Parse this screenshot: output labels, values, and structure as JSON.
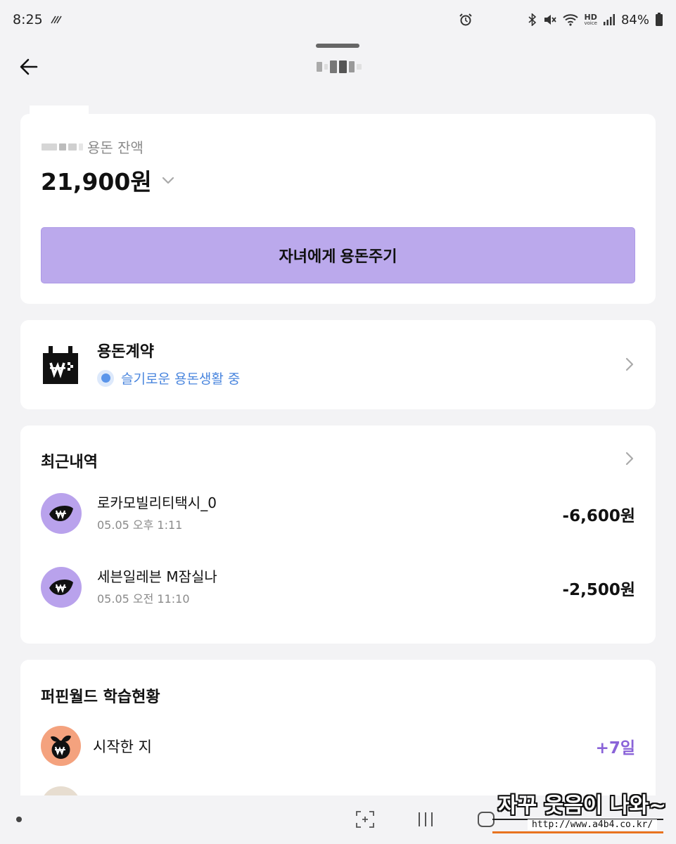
{
  "status_bar": {
    "time": "8:25",
    "battery": "84%",
    "icons": [
      "sync-icon",
      "alarm-icon",
      "bluetooth-icon",
      "mute-icon",
      "wifi-icon",
      "hd-voice-icon",
      "signal-icon",
      "battery-icon"
    ],
    "hd_top": "HD",
    "hd_bottom": "voice"
  },
  "header": {
    "back_icon": "back-arrow-icon"
  },
  "balance": {
    "label": "용돈 잔액",
    "amount": "21,900원",
    "give_button": "자녀에게 용돈주기"
  },
  "contract": {
    "title": "용돈계약",
    "status": "슬기로운 용돈생활 중",
    "icon": "calendar-won-icon"
  },
  "recent": {
    "title": "최근내역",
    "transactions": [
      {
        "name": "로카모빌리티택시_0",
        "date": "05.05 오후 1:11",
        "amount": "-6,600원"
      },
      {
        "name": "세븐일레븐 M잠실나",
        "date": "05.05 오전 11:10",
        "amount": "-2,500원"
      }
    ]
  },
  "learning": {
    "title": "퍼핀월드 학습현황",
    "rows": [
      {
        "label": "시작한 지",
        "value": "+7일"
      }
    ]
  },
  "nav": {
    "buttons": [
      "screenshot-icon",
      "recents-icon",
      "home-icon"
    ]
  },
  "watermark": {
    "text": "자꾸 웃음이 나와~",
    "url": "http://www.a4b4.co.kr/"
  },
  "colors": {
    "background": "#f3f3f5",
    "card": "#ffffff",
    "primary_button": "#bba9ec",
    "accent_purple": "#8a63d8",
    "status_blue": "#4a86de",
    "tx_icon_bg": "#b9a2ec",
    "learn_icon_bg": "#f4a27e"
  }
}
